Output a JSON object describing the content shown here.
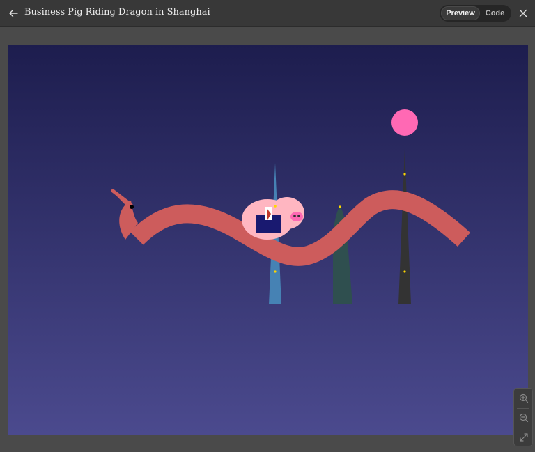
{
  "header": {
    "title": "Business Pig Riding Dragon in Shanghai",
    "tabs": [
      {
        "label": "Preview",
        "active": true
      },
      {
        "label": "Code",
        "active": false
      }
    ]
  },
  "icons": {
    "back": "arrow-left-icon",
    "close": "close-icon",
    "zoom_in": "zoom-in-icon",
    "zoom_out": "zoom-out-icon",
    "fit": "expand-icon"
  },
  "colors": {
    "sky_top": "#1d1d4e",
    "sky_bottom": "#4b4a8e",
    "dragon": "#cd5c5c",
    "pig": "#ffb6c1",
    "pig_snout": "#ff69b4",
    "suit": "#191970",
    "moon": "#ff69b4",
    "tower_blue": "#4682b4",
    "tower_green": "#2f4f4f",
    "tower_dark": "#333333",
    "window_light": "#ffd700"
  }
}
